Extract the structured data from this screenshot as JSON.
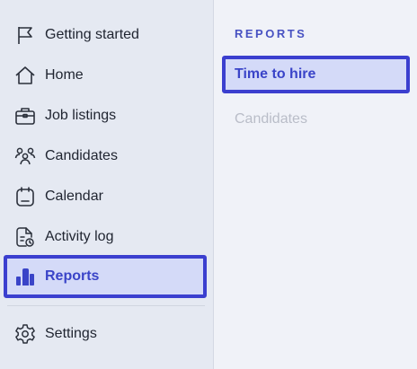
{
  "sidebar": {
    "items": [
      {
        "label": "Getting started",
        "icon": "flag-icon"
      },
      {
        "label": "Home",
        "icon": "home-icon"
      },
      {
        "label": "Job listings",
        "icon": "briefcase-icon"
      },
      {
        "label": "Candidates",
        "icon": "people-icon"
      },
      {
        "label": "Calendar",
        "icon": "calendar-icon"
      },
      {
        "label": "Activity log",
        "icon": "activity-log-icon"
      },
      {
        "label": "Reports",
        "icon": "bar-chart-icon",
        "active": true
      }
    ],
    "settings": {
      "label": "Settings",
      "icon": "gear-icon"
    }
  },
  "reports_panel": {
    "title": "REPORTS",
    "items": [
      {
        "label": "Time to hire",
        "active": true
      },
      {
        "label": "Candidates",
        "disabled": true
      }
    ]
  },
  "colors": {
    "accent": "#3b3fcf",
    "active_bg": "#d4daf8",
    "sidebar_bg": "#e5e9f2",
    "main_bg": "#f0f2f8"
  }
}
